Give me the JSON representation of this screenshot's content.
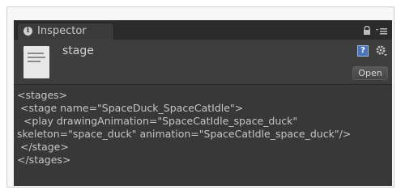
{
  "tab": {
    "label": "Inspector"
  },
  "asset": {
    "name": "stage"
  },
  "actions": {
    "open_label": "Open",
    "help_glyph": "?"
  },
  "icons": [
    "info-icon",
    "lock-icon",
    "menu-icon",
    "file-icon",
    "help-icon",
    "gear-icon"
  ],
  "colors": {
    "panel": "#3b3b3b",
    "text": "#c6c6c6",
    "help_accent": "#4a74b8"
  },
  "code": [
    "<stages>",
    " <stage name=\"SpaceDuck_SpaceCatIdle\">",
    "  <play drawingAnimation=\"SpaceCatIdle_space_duck\"",
    "skeleton=\"space_duck\" animation=\"SpaceCatIdle_space_duck\"/>",
    " </stage>",
    "</stages>"
  ]
}
